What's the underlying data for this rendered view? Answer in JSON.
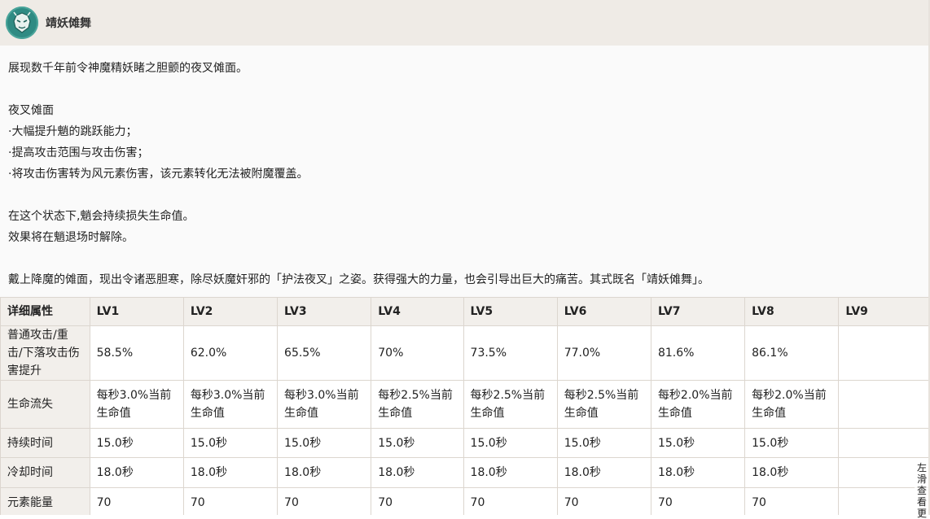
{
  "header": {
    "title": "靖妖傩舞",
    "accent_color": "#2f8b83"
  },
  "description": [
    "展现数千年前令神魔精妖睹之胆颤的夜叉傩面。",
    "",
    "夜叉傩面",
    "·大幅提升魈的跳跃能力；",
    "·提高攻击范围与攻击伤害；",
    "·将攻击伤害转为风元素伤害，该元素转化无法被附魔覆盖。",
    "",
    "在这个状态下,魈会持续损失生命值。",
    "效果将在魈退场时解除。",
    "",
    "戴上降魔的傩面，现出令诸恶胆寒，除尽妖魔奸邪的「护法夜叉」之姿。获得强大的力量，也会引导出巨大的痛苦。其式既名「靖妖傩舞」。"
  ],
  "table": {
    "headers": [
      "详细属性",
      "LV1",
      "LV2",
      "LV3",
      "LV4",
      "LV5",
      "LV6",
      "LV7",
      "LV8",
      "LV9"
    ],
    "rows": [
      {
        "label": "普通攻击/重击/下落攻击伤害提升",
        "cells": [
          "58.5%",
          "62.0%",
          "65.5%",
          "70%",
          "73.5%",
          "77.0%",
          "81.6%",
          "86.1%",
          ""
        ]
      },
      {
        "label": "生命流失",
        "cells": [
          "每秒3.0%当前生命值",
          "每秒3.0%当前生命值",
          "每秒3.0%当前生命值",
          "每秒2.5%当前生命值",
          "每秒2.5%当前生命值",
          "每秒2.5%当前生命值",
          "每秒2.0%当前生命值",
          "每秒2.0%当前生命值",
          ""
        ]
      },
      {
        "label": "持续时间",
        "cells": [
          "15.0秒",
          "15.0秒",
          "15.0秒",
          "15.0秒",
          "15.0秒",
          "15.0秒",
          "15.0秒",
          "15.0秒",
          ""
        ]
      },
      {
        "label": "冷却时间",
        "cells": [
          "18.0秒",
          "18.0秒",
          "18.0秒",
          "18.0秒",
          "18.0秒",
          "18.0秒",
          "18.0秒",
          "18.0秒",
          ""
        ]
      },
      {
        "label": "元素能量",
        "cells": [
          "70",
          "70",
          "70",
          "70",
          "70",
          "70",
          "70",
          "70",
          ""
        ]
      }
    ]
  },
  "slide_hint": "左滑查看更"
}
